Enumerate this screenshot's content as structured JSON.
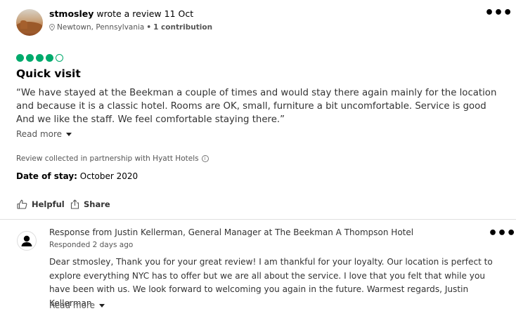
{
  "review": {
    "username": "stmosley",
    "action_text": " wrote a review 11 Oct",
    "location": "Newtown, Pennsylvania",
    "separator": "•",
    "contributions": "1 contribution",
    "rating": {
      "value": 4,
      "max": 5
    },
    "title": "Quick visit",
    "body": "“We have stayed at the Beekman a couple of times and would stay there again mainly for the location and because it is a classic hotel. Rooms are OK, small, furniture a bit uncomfortable. Service is good And we like the staff. We feel comfortable staying there.”",
    "read_more": "Read more",
    "collected_note": "Review collected in partnership with Hyatt Hotels",
    "date_of_stay_label": "Date of stay:",
    "date_of_stay_value": " October 2020",
    "helpful_label": "Helpful",
    "share_label": "Share"
  },
  "response": {
    "header": "Response from Justin Kellerman, General Manager at The Beekman A Thompson Hotel",
    "date": "Responded 2 days ago",
    "body": "Dear stmosley, Thank you for your great review! I am thankful for your loyalty. Our location is perfect to explore everything NYC has to offer but we are all about the service. I love that you felt that while you have been with us. We look forward to welcoming you again in the future. Warmest regards, Justin Kellerman",
    "read_more": "Read more"
  },
  "icons": {
    "menu": "more-options-icon",
    "pin": "location-pin-icon",
    "info": "info-icon",
    "helpful": "thumbs-up-icon",
    "share": "share-icon",
    "caret": "chevron-down-icon",
    "person": "person-icon"
  },
  "colors": {
    "rating_green": "#00aa6c",
    "text_primary": "#000000",
    "text_secondary": "#555555",
    "divider": "#e0e0e0"
  }
}
